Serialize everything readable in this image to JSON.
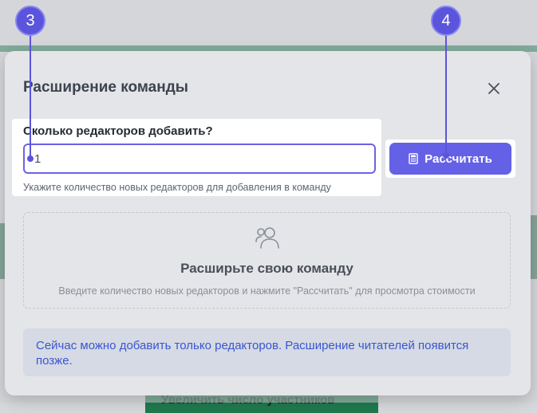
{
  "background": {
    "topbar_text": "",
    "bottom_button_label": "Увеличить число участников"
  },
  "modal": {
    "title": "Расширение команды",
    "close_icon": "close-icon",
    "field": {
      "label": "Сколько редакторов добавить?",
      "value": "1",
      "placeholder": "",
      "hint": "Укажите количество новых редакторов для добавления в команду"
    },
    "calculate_button": {
      "icon": "calculator-icon",
      "label": "Рассчитать"
    },
    "empty_state": {
      "icon": "users-icon",
      "title": "Расширьте свою команду",
      "subtitle": "Введите количество новых редакторов и нажмите \"Рассчитать\" для просмотра стоимости"
    },
    "info": {
      "text": "Сейчас можно добавить только редакторов. Расширение читателей появится позже."
    }
  },
  "markers": [
    {
      "label": "3"
    },
    {
      "label": "4"
    }
  ],
  "colors": {
    "accent": "#6461e6",
    "marker": "#5a55dc",
    "info_text": "#3b55cf",
    "app_green": "#1f7a4e"
  }
}
